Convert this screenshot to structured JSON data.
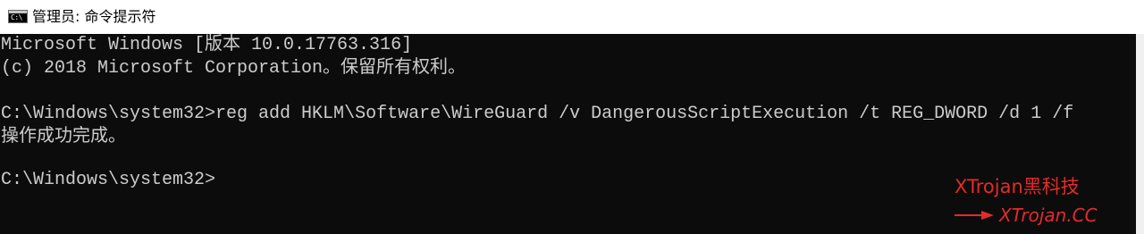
{
  "window": {
    "title": "管理员: 命令提示符",
    "icon_glyph": "C:\\",
    "icon_name": "cmd-icon"
  },
  "console": {
    "lines": [
      "Microsoft Windows [版本 10.0.17763.316]",
      "(c) 2018 Microsoft Corporation。保留所有权利。",
      "",
      "C:\\Windows\\system32>reg add HKLM\\Software\\WireGuard /v DangerousScriptExecution /t REG_DWORD /d 1 /f",
      "操作成功完成。",
      "",
      "C:\\Windows\\system32>"
    ],
    "text_color": "#cccccc",
    "background_color": "#0c0c0c"
  },
  "watermark": {
    "line1": "XTrojan黑科技",
    "line2": "XTrojan.CC",
    "arrow_icon": "arrow-right-icon",
    "color": "#e52a2a"
  }
}
